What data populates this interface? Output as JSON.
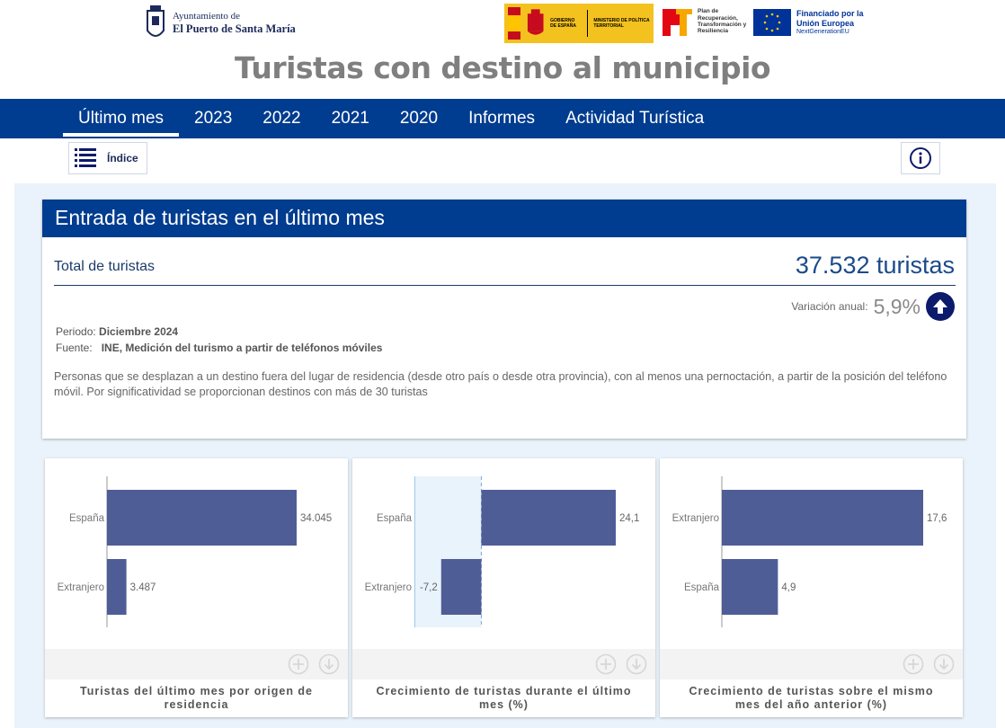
{
  "header": {
    "city_line1": "Ayuntamiento de",
    "city_line2": "El Puerto de Santa María",
    "gov_line1": "GOBIERNO DE ESPAÑA",
    "gov_line2": "MINISTERIO DE POLÍTICA TERRITORIAL",
    "prtr_line": "Plan de Recuperación, Transformación y Resiliencia",
    "eu_line1": "Financiado por la Unión Europea",
    "eu_line2": "NextGenerationEU",
    "title": "Turistas con destino al municipio"
  },
  "nav": {
    "items": [
      "Último mes",
      "2023",
      "2022",
      "2021",
      "2020",
      "Informes",
      "Actividad Turística"
    ],
    "active": 0
  },
  "toolbar": {
    "index_label": "Índice"
  },
  "section": {
    "title": "Entrada de turistas en el último mes",
    "total_label": "Total de turistas",
    "total_value": "37.532 turistas",
    "variation_label": "Variación anual:",
    "variation_value": "5,9%",
    "period_label": "Periodo:",
    "period_value": "Diciembre 2024",
    "source_label": "Fuente:",
    "source_value": "INE, Medición del turismo a partir de teléfonos móviles",
    "description": "Personas que se desplazan a un destino fuera del lugar de residencia (desde otro país o desde otra provincia), con al menos una pernoctación, a partir de la posición del teléfono móvil. Por significatividad se proporcionan destinos con más de 30 turistas"
  },
  "colors": {
    "nav": "#003c8f",
    "bar": "#4f5d97",
    "accent": "#0b1a6b"
  },
  "chart_data": [
    {
      "type": "bar",
      "orientation": "horizontal",
      "title": "Turistas del último mes por origen de residencia",
      "categories": [
        "España",
        "Extranjero"
      ],
      "values": [
        34045,
        3487
      ],
      "labels": [
        "34.045",
        "3.487"
      ],
      "xlim": [
        0,
        34045
      ]
    },
    {
      "type": "bar",
      "orientation": "horizontal",
      "title": "Crecimiento de turistas durante el último mes (%)",
      "categories": [
        "España",
        "Extranjero"
      ],
      "values": [
        24.1,
        -7.2
      ],
      "labels": [
        "24,1",
        "-7,2"
      ],
      "xlim": [
        -12,
        24.1
      ]
    },
    {
      "type": "bar",
      "orientation": "horizontal",
      "title": "Crecimiento de turistas sobre el mismo mes del año anterior (%)",
      "categories": [
        "Extranjero",
        "España"
      ],
      "values": [
        17.6,
        4.9
      ],
      "labels": [
        "17,6",
        "4,9"
      ],
      "xlim": [
        0,
        17.6
      ]
    }
  ]
}
